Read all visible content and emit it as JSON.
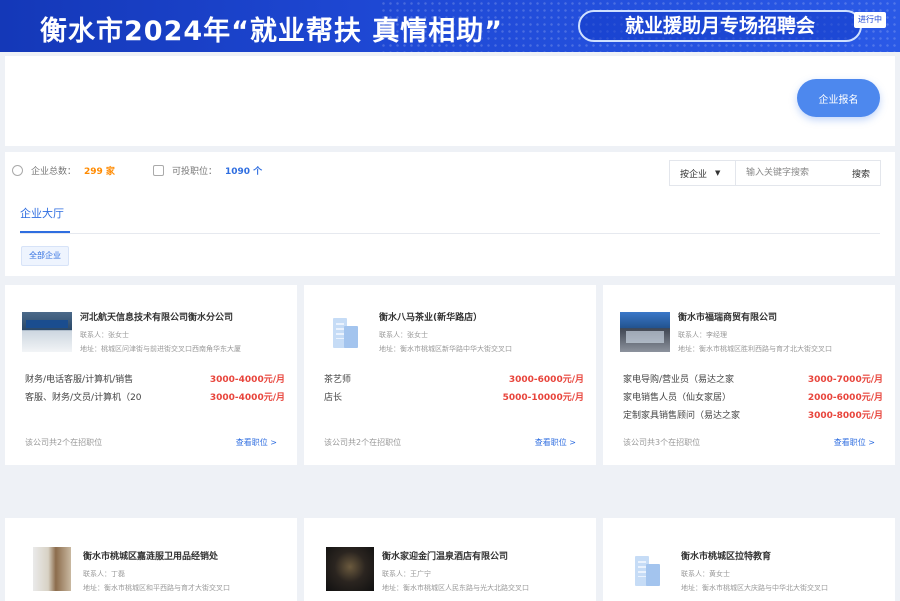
{
  "banner": {
    "title": "衡水市2024年“就业帮扶 真情相助”",
    "subtitle": "就业援助月专场招聘会",
    "status": "进行中"
  },
  "header": {
    "apply_button": "企业报名"
  },
  "stats": {
    "companies_label": "企业总数：",
    "companies_value": "299 家",
    "positions_label": "可投职位：",
    "positions_value": "1090 个"
  },
  "search": {
    "select_value": "按企业",
    "placeholder": "输入关键字搜索",
    "button": "搜索"
  },
  "tabs": {
    "active": "企业大厅"
  },
  "filter": {
    "chip": "全部企业"
  },
  "cards": [
    {
      "name": "河北航天信息技术有限公司衡水分公司",
      "contact": "联系人：张女士",
      "address": "地址：桃城区问津街与前进街交叉口西南角华东大厦",
      "jobs": [
        {
          "title": "财务/电话客服/计算机/销售",
          "salary": "3000-4000元/月"
        },
        {
          "title": "客服、财务/文员/计算机（20",
          "salary": "3000-4000元/月"
        }
      ],
      "footer_count": "该公司共2个在招职位",
      "footer_more": "查看职位 >"
    },
    {
      "name": "衡水八马茶业(新华路店）",
      "contact": "联系人：张女士",
      "address": "地址：衡水市桃城区新华路中华大街交叉口",
      "jobs": [
        {
          "title": "茶艺师",
          "salary": "3000-6000元/月"
        },
        {
          "title": "店长",
          "salary": "5000-10000元/月"
        }
      ],
      "footer_count": "该公司共2个在招职位",
      "footer_more": "查看职位 >"
    },
    {
      "name": "衡水市福瑞商贸有限公司",
      "contact": "联系人：李经理",
      "address": "地址：衡水市桃城区胜利西路与育才北大街交叉口",
      "jobs": [
        {
          "title": "家电导购/营业员（易达之家",
          "salary": "3000-7000元/月"
        },
        {
          "title": "家电销售人员（仙女家居）",
          "salary": "2000-6000元/月"
        },
        {
          "title": "定制家具销售顾问（易达之家",
          "salary": "3000-8000元/月"
        }
      ],
      "footer_count": "该公司共3个在招职位",
      "footer_more": "查看职位 >"
    },
    {
      "name": "衡水市桃城区嘉涟服卫用品经销处",
      "contact": "联系人：丁磊",
      "address": "地址：衡水市桃城区和平西路与育才大街交叉口",
      "jobs": []
    },
    {
      "name": "衡水家迎金门温泉酒店有限公司",
      "contact": "联系人：王广宁",
      "address": "地址：衡水市桃城区人民东路与光大北路交叉口",
      "jobs": []
    },
    {
      "name": "衡水市桃城区拉特教育",
      "contact": "联系人：黄女士",
      "address": "地址：衡水市桃城区大庆路与中华北大街交叉口",
      "jobs": []
    }
  ]
}
